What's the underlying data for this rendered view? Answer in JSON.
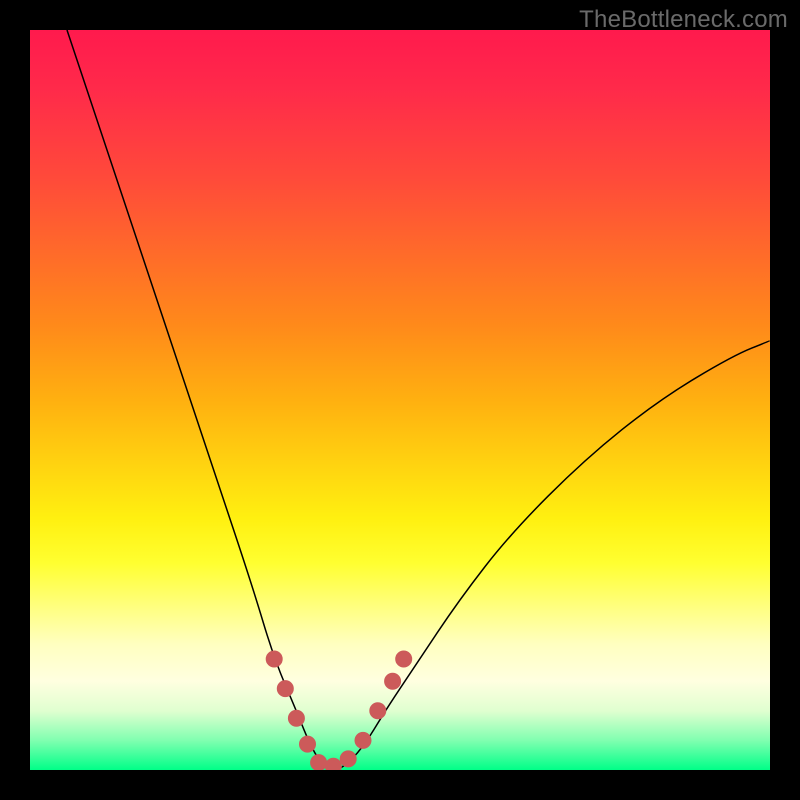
{
  "watermark": "TheBottleneck.com",
  "chart_data": {
    "type": "line",
    "title": "",
    "xlabel": "",
    "ylabel": "",
    "xlim": [
      0,
      100
    ],
    "ylim": [
      0,
      100
    ],
    "background_gradient": {
      "top": "#ff1a4d",
      "mid": "#fff010",
      "bottom": "#00ff88"
    },
    "series": [
      {
        "name": "bottleneck-curve",
        "x": [
          5,
          10,
          15,
          20,
          25,
          30,
          33,
          36,
          38,
          40,
          42,
          45,
          48,
          52,
          58,
          65,
          75,
          85,
          95,
          100
        ],
        "y": [
          100,
          85,
          70,
          55,
          40,
          25,
          15,
          8,
          3,
          0,
          0,
          3,
          8,
          14,
          23,
          32,
          42,
          50,
          56,
          58
        ]
      }
    ],
    "markers": {
      "name": "highlight-dots",
      "color": "#cc5a5a",
      "points": [
        {
          "x": 33,
          "y": 15
        },
        {
          "x": 34.5,
          "y": 11
        },
        {
          "x": 36,
          "y": 7
        },
        {
          "x": 37.5,
          "y": 3.5
        },
        {
          "x": 39,
          "y": 1
        },
        {
          "x": 41,
          "y": 0.5
        },
        {
          "x": 43,
          "y": 1.5
        },
        {
          "x": 45,
          "y": 4
        },
        {
          "x": 47,
          "y": 8
        },
        {
          "x": 49,
          "y": 12
        },
        {
          "x": 50.5,
          "y": 15
        }
      ]
    }
  }
}
